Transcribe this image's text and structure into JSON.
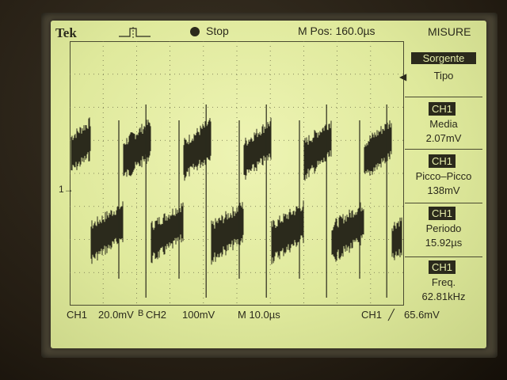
{
  "header": {
    "brand": "Tek",
    "run_state": "Stop",
    "position": "M Pos: 160.0µs",
    "menu_title": "MISURE"
  },
  "side_menu": {
    "source_label_1": "Sorgente",
    "source_label_2": "Tipo",
    "measurements": [
      {
        "channel": "CH1",
        "type": "Media",
        "value": "2.07mV"
      },
      {
        "channel": "CH1",
        "type": "Picco–Picco",
        "value": "138mV"
      },
      {
        "channel": "CH1",
        "type": "Periodo",
        "value": "15.92µs"
      },
      {
        "channel": "CH1",
        "type": "Freq.",
        "value": "62.81kHz"
      }
    ]
  },
  "footer": {
    "ch1_label": "CH1",
    "ch1_scale": "20.0mV",
    "bw_mark": "B",
    "ch2_label": "CH2",
    "ch2_scale": "100mV",
    "timebase": "M 10.0µs",
    "trigger_source": "CH1",
    "trigger_slope": "╱",
    "trigger_level": "65.6mV"
  },
  "channel_marker": "1→",
  "colors": {
    "screen": "#dfe99c",
    "trace": "#2b2a1c",
    "bezel": "#2a2319"
  }
}
